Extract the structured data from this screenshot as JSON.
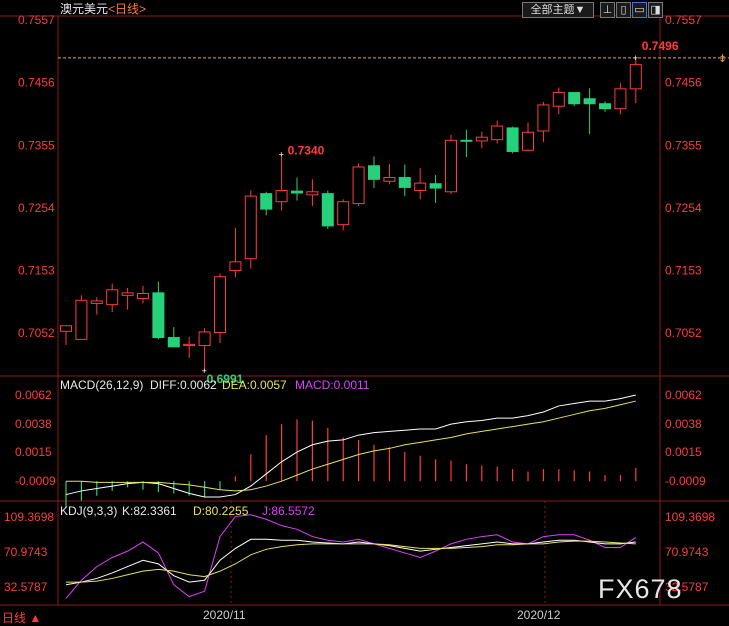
{
  "header": {
    "symbol": "澳元美元",
    "period_tag": "<日线>",
    "theme_label": "全部主题",
    "theme_arrow": "▼"
  },
  "toolbar_icons": [
    "pin-icon",
    "chart-layout-icon",
    "window-icon",
    "sidebar-toggle-icon"
  ],
  "colors": {
    "up": "#ff3b3b",
    "down": "#27d07a",
    "diff_line": "#ffffff",
    "dea_line": "#e8e05a",
    "macd_label": "#e040fb",
    "kdj_j": "#e040fb",
    "axis_text": "#ff3b3b",
    "grid": "#8b1a1a",
    "last_price_line": "#e0a050"
  },
  "price_axis": {
    "ticks": [
      "0.7557",
      "0.7456",
      "0.7355",
      "0.7254",
      "0.7153",
      "0.7052"
    ],
    "range": [
      0.6991,
      0.7557
    ]
  },
  "annotations": {
    "high": "0.7496",
    "mid_high": "0.7340",
    "low": "0.6991"
  },
  "date_labels": [
    "2020/11",
    "2020/12"
  ],
  "macd_panel": {
    "title": "MACD(26,12,9)",
    "diff_label": "DIFF:0.0062",
    "dea_label": "DEA:0.0057",
    "macd_label": "MACD:0.0011",
    "ticks": [
      "0.0062",
      "0.0038",
      "0.0015",
      "-0.0009"
    ]
  },
  "kdj_panel": {
    "title": "KDJ(9,3,3)",
    "k_label": "K:82.3361",
    "d_label": "D:80.2255",
    "j_label": "J:86.5572",
    "ticks": [
      "109.3698",
      "70.9743",
      "32.5787"
    ]
  },
  "period_tab": "日线 ▲",
  "watermark": "FX678",
  "chart_data": {
    "type": "candlestick",
    "candles": [
      {
        "o": 0.7055,
        "h": 0.7064,
        "l": 0.7033,
        "c": 0.7064
      },
      {
        "o": 0.7042,
        "h": 0.7113,
        "l": 0.7042,
        "c": 0.7105
      },
      {
        "o": 0.71,
        "h": 0.711,
        "l": 0.7082,
        "c": 0.7104
      },
      {
        "o": 0.7098,
        "h": 0.7132,
        "l": 0.7086,
        "c": 0.7122
      },
      {
        "o": 0.7113,
        "h": 0.7125,
        "l": 0.709,
        "c": 0.7117
      },
      {
        "o": 0.7108,
        "h": 0.7128,
        "l": 0.71,
        "c": 0.7116
      },
      {
        "o": 0.7117,
        "h": 0.7135,
        "l": 0.7042,
        "c": 0.7045
      },
      {
        "o": 0.7045,
        "h": 0.7062,
        "l": 0.703,
        "c": 0.703
      },
      {
        "o": 0.7032,
        "h": 0.7046,
        "l": 0.7012,
        "c": 0.7034
      },
      {
        "o": 0.7032,
        "h": 0.706,
        "l": 0.6991,
        "c": 0.7054
      },
      {
        "o": 0.7053,
        "h": 0.7148,
        "l": 0.7036,
        "c": 0.7143
      },
      {
        "o": 0.7153,
        "h": 0.7222,
        "l": 0.7142,
        "c": 0.7167
      },
      {
        "o": 0.7172,
        "h": 0.7282,
        "l": 0.7156,
        "c": 0.7273
      },
      {
        "o": 0.7277,
        "h": 0.728,
        "l": 0.7242,
        "c": 0.7252
      },
      {
        "o": 0.7264,
        "h": 0.734,
        "l": 0.725,
        "c": 0.7282
      },
      {
        "o": 0.7281,
        "h": 0.7303,
        "l": 0.7266,
        "c": 0.7278
      },
      {
        "o": 0.7275,
        "h": 0.73,
        "l": 0.7257,
        "c": 0.728
      },
      {
        "o": 0.7277,
        "h": 0.7282,
        "l": 0.722,
        "c": 0.7225
      },
      {
        "o": 0.7227,
        "h": 0.7268,
        "l": 0.7218,
        "c": 0.7264
      },
      {
        "o": 0.7261,
        "h": 0.7326,
        "l": 0.7257,
        "c": 0.732
      },
      {
        "o": 0.7322,
        "h": 0.7337,
        "l": 0.7286,
        "c": 0.73
      },
      {
        "o": 0.7297,
        "h": 0.7325,
        "l": 0.7292,
        "c": 0.7303
      },
      {
        "o": 0.7303,
        "h": 0.7324,
        "l": 0.7273,
        "c": 0.7287
      },
      {
        "o": 0.7282,
        "h": 0.7318,
        "l": 0.7268,
        "c": 0.7294
      },
      {
        "o": 0.7293,
        "h": 0.7307,
        "l": 0.7262,
        "c": 0.7286
      },
      {
        "o": 0.728,
        "h": 0.7372,
        "l": 0.7276,
        "c": 0.7363
      },
      {
        "o": 0.7363,
        "h": 0.738,
        "l": 0.7336,
        "c": 0.7362
      },
      {
        "o": 0.7362,
        "h": 0.7377,
        "l": 0.735,
        "c": 0.7368
      },
      {
        "o": 0.7364,
        "h": 0.7395,
        "l": 0.7358,
        "c": 0.7386
      },
      {
        "o": 0.7383,
        "h": 0.7385,
        "l": 0.7342,
        "c": 0.7345
      },
      {
        "o": 0.7347,
        "h": 0.7392,
        "l": 0.7345,
        "c": 0.7376
      },
      {
        "o": 0.7378,
        "h": 0.7425,
        "l": 0.736,
        "c": 0.742
      },
      {
        "o": 0.7418,
        "h": 0.7448,
        "l": 0.7405,
        "c": 0.744
      },
      {
        "o": 0.744,
        "h": 0.744,
        "l": 0.7418,
        "c": 0.7422
      },
      {
        "o": 0.743,
        "h": 0.7447,
        "l": 0.7373,
        "c": 0.7422
      },
      {
        "o": 0.7422,
        "h": 0.7426,
        "l": 0.7409,
        "c": 0.7414
      },
      {
        "o": 0.7414,
        "h": 0.7455,
        "l": 0.7405,
        "c": 0.7446
      },
      {
        "o": 0.7446,
        "h": 0.7496,
        "l": 0.7423,
        "c": 0.7485
      }
    ],
    "macd": {
      "hist": [
        -0.0022,
        -0.0016,
        -0.0012,
        -0.0008,
        -0.0005,
        -0.0007,
        -0.0009,
        -0.001,
        -0.0012,
        -0.0013,
        -0.0007,
        0.0004,
        0.0022,
        0.0038,
        0.0047,
        0.0051,
        0.005,
        0.0044,
        0.0036,
        0.0034,
        0.003,
        0.0028,
        0.0024,
        0.0021,
        0.0018,
        0.0017,
        0.0014,
        0.0013,
        0.0012,
        0.001,
        0.0008,
        0.001,
        0.001,
        0.0009,
        0.0008,
        0.0005,
        0.0005,
        0.0011
      ],
      "diff": [
        -0.002,
        -0.0017,
        -0.0015,
        -0.0013,
        -0.0011,
        -0.001,
        -0.0011,
        -0.0015,
        -0.0019,
        -0.0022,
        -0.0022,
        -0.002,
        -0.0013,
        -0.0003,
        0.0007,
        0.0015,
        0.0021,
        0.0024,
        0.0025,
        0.0029,
        0.0031,
        0.0032,
        0.0033,
        0.0034,
        0.0034,
        0.0038,
        0.004,
        0.0041,
        0.0043,
        0.0043,
        0.0045,
        0.0048,
        0.0053,
        0.0055,
        0.0057,
        0.0057,
        0.0059,
        0.0062
      ],
      "dea": [
        -0.0009,
        -0.0009,
        -0.001,
        -0.001,
        -0.001,
        -0.001,
        -0.001,
        -0.0011,
        -0.0012,
        -0.0014,
        -0.0016,
        -0.0017,
        -0.0016,
        -0.0013,
        -0.0009,
        -0.0004,
        0.0001,
        0.0005,
        0.0009,
        0.0013,
        0.0016,
        0.0018,
        0.0021,
        0.0023,
        0.0025,
        0.0027,
        0.003,
        0.0032,
        0.0034,
        0.0036,
        0.0038,
        0.004,
        0.0043,
        0.0046,
        0.0049,
        0.0051,
        0.0054,
        0.0057
      ],
      "ylim": [
        -0.0022,
        0.0062
      ]
    },
    "kdj": {
      "k": [
        35,
        38,
        42,
        48,
        55,
        62,
        58,
        45,
        38,
        40,
        62,
        75,
        85,
        85,
        84,
        84,
        82,
        81,
        80,
        82,
        80,
        78,
        75,
        72,
        74,
        76,
        78,
        80,
        82,
        80,
        80,
        82,
        84,
        84,
        82,
        80,
        80,
        82
      ],
      "d": [
        38,
        38,
        39,
        42,
        46,
        50,
        52,
        50,
        46,
        44,
        50,
        58,
        68,
        74,
        77,
        79,
        80,
        80,
        80,
        80,
        80,
        79,
        77,
        75,
        75,
        75,
        76,
        77,
        79,
        79,
        80,
        80,
        82,
        83,
        83,
        82,
        81,
        80
      ],
      "j": [
        20,
        40,
        55,
        65,
        72,
        82,
        70,
        35,
        22,
        28,
        88,
        110,
        112,
        107,
        100,
        96,
        88,
        84,
        82,
        85,
        80,
        75,
        70,
        65,
        72,
        80,
        85,
        88,
        90,
        82,
        80,
        88,
        90,
        90,
        84,
        76,
        76,
        87
      ],
      "ylim": [
        15,
        115
      ]
    }
  }
}
